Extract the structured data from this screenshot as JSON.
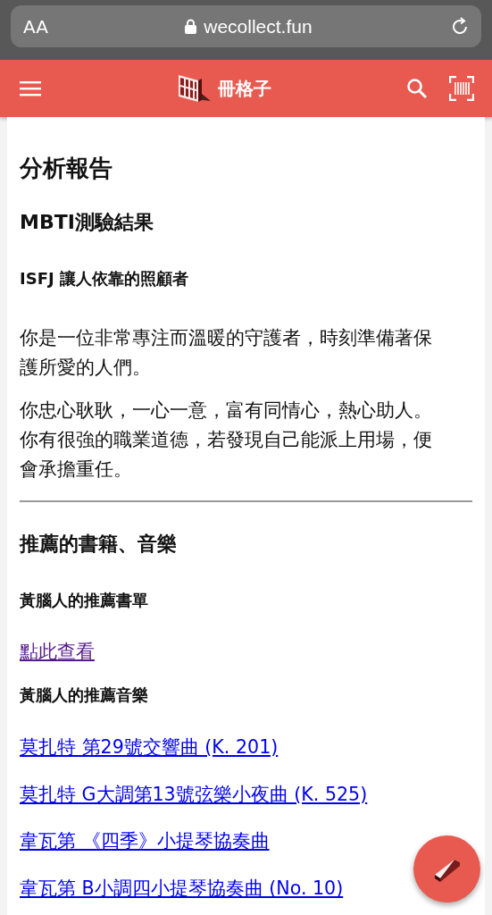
{
  "browser": {
    "text_size_label": "AA",
    "address": "wecollect.fun"
  },
  "app_bar": {
    "title": "冊格子"
  },
  "report": {
    "title": "分析報告",
    "section_title": "MBTI測驗結果",
    "type_title": "ISFJ 讓人依靠的照顧者",
    "paragraphs": [
      "你是一位非常專注而溫暖的守護者，時刻準備著保護所愛的人們。",
      "你忠心耿耿，一心一意，富有同情心，熱心助人。你有很強的職業道德，若發現自己能派上用場，便會承擔重任。"
    ]
  },
  "recommendations": {
    "title": "推薦的書籍、音樂",
    "groups": [
      {
        "title": "黃腦人的推薦書單",
        "links": [
          {
            "text": "點此查看",
            "visited": true
          }
        ]
      },
      {
        "title": "黃腦人的推薦音樂",
        "links": [
          {
            "text": "莫扎特 第29號交響曲 (K. 201)",
            "visited": false
          },
          {
            "text": "莫扎特 G大調第13號弦樂小夜曲 (K. 525)",
            "visited": false
          },
          {
            "text": "韋瓦第 《四季》小提琴協奏曲",
            "visited": false
          },
          {
            "text": "韋瓦第 B小調四小提琴協奏曲 (No. 10)",
            "visited": false
          }
        ]
      }
    ]
  }
}
